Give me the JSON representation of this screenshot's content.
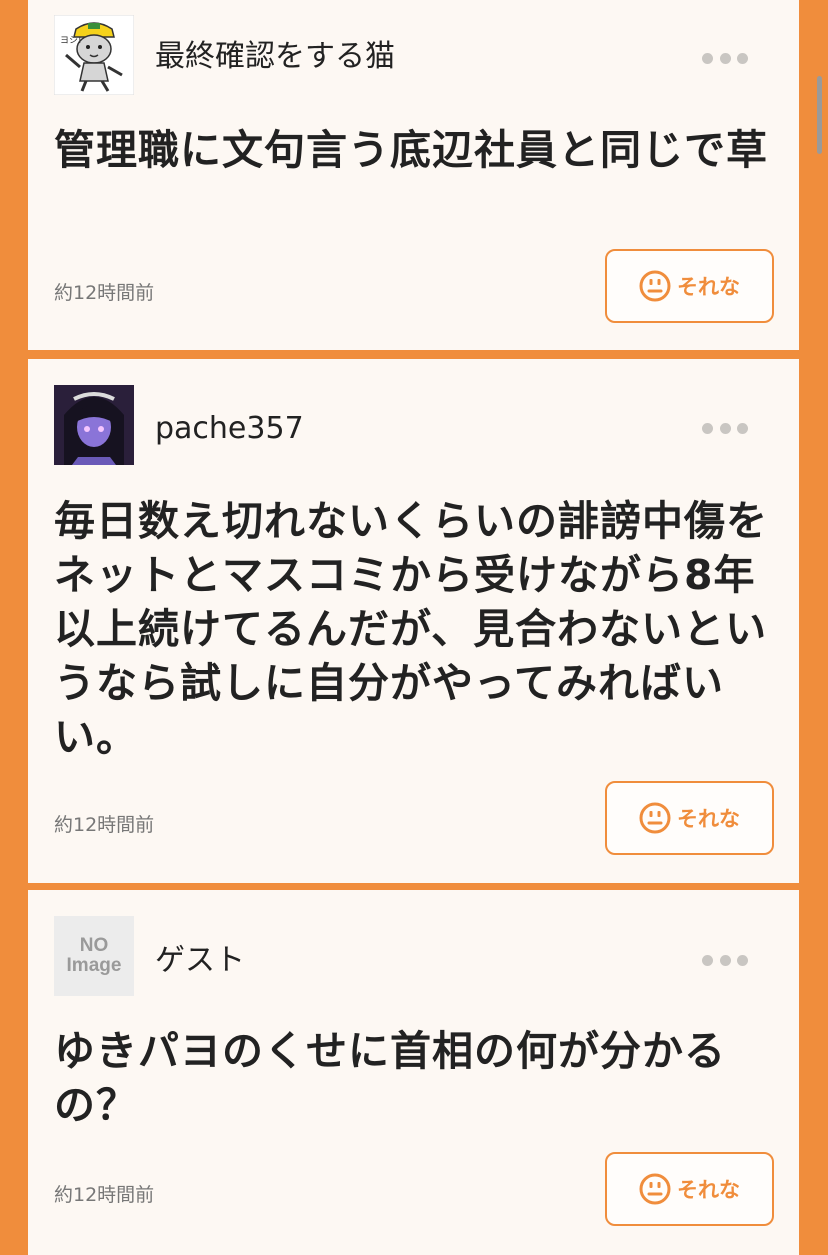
{
  "colors": {
    "accent": "#f08d3c",
    "card_background": "#fdf8f3",
    "text": "#222222",
    "muted_text": "#777777",
    "dots": "#c9c6c2"
  },
  "posts": [
    {
      "username": "最終確認をする猫",
      "avatar": "cat-avatar",
      "body": "管理職に文句言う底辺社員と同じで草",
      "timestamp": "約12時間前",
      "reaction_label": "それな",
      "reaction_icon": "face-icon"
    },
    {
      "username": "pache357",
      "avatar": "girl-avatar",
      "body": "毎日数え切れないくらいの誹謗中傷をネットとマスコミから受けながら8年以上続けてるんだが、見合わないというなら試しに自分がやってみればいい。",
      "timestamp": "約12時間前",
      "reaction_label": "それな",
      "reaction_icon": "face-icon"
    },
    {
      "username": "ゲスト",
      "avatar": "no-image-avatar",
      "avatar_text_line1": "NO",
      "avatar_text_line2": "Image",
      "body": "ゆきパヨのくせに首相の何が分かるの？",
      "timestamp": "約12時間前",
      "reaction_label": "それな",
      "reaction_icon": "face-icon"
    }
  ]
}
